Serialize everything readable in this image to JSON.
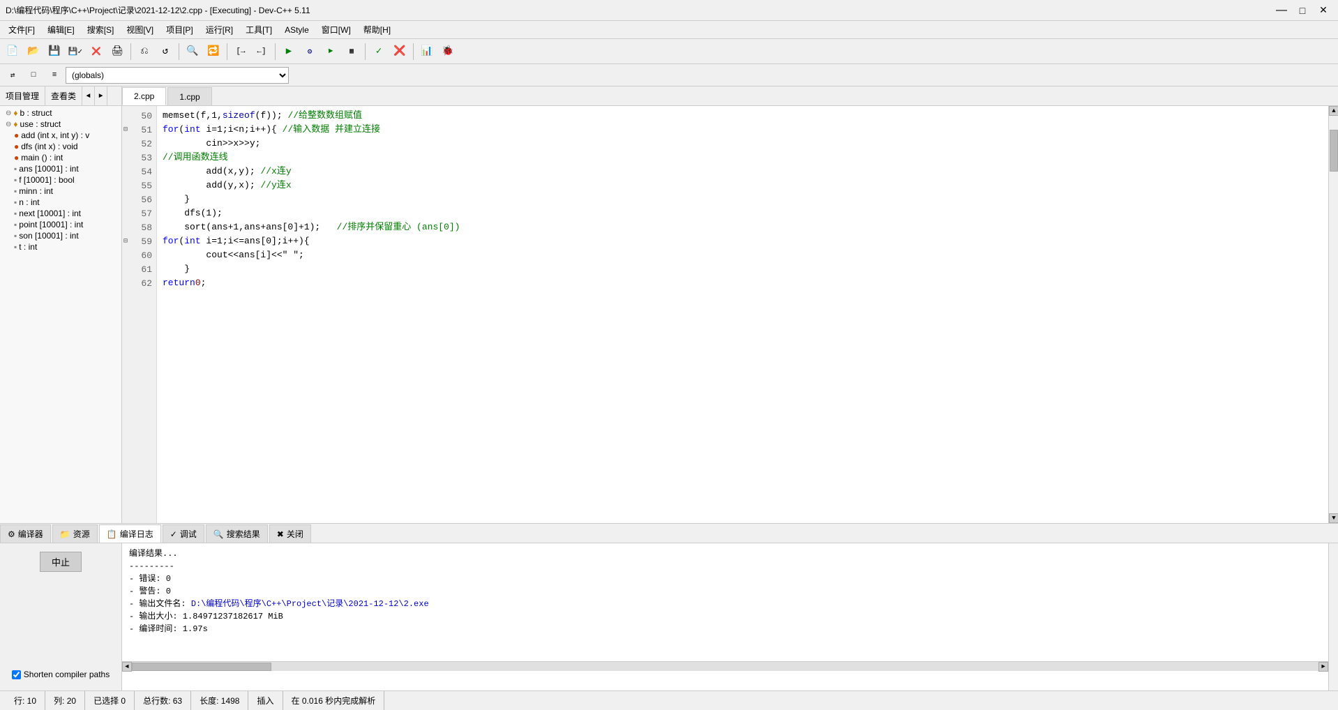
{
  "titlebar": {
    "title": "D:\\编程代码\\程序\\C++\\Project\\记录\\2021-12-12\\2.cpp - [Executing] - Dev-C++ 5.11",
    "minimize": "—",
    "maximize": "□",
    "close": "✕"
  },
  "menubar": {
    "items": [
      "文件[F]",
      "编辑[E]",
      "搜索[S]",
      "视图[V]",
      "项目[P]",
      "运行[R]",
      "工具[T]",
      "AStyle",
      "窗口[W]",
      "帮助[H]"
    ]
  },
  "toolbar2": {
    "globals_value": "(globals)"
  },
  "left_panel": {
    "tabs": [
      "项目管理",
      "查看类"
    ],
    "tree_items": [
      {
        "indent": 0,
        "expand": true,
        "icon": "struct",
        "label": "b : struct"
      },
      {
        "indent": 0,
        "expand": true,
        "icon": "struct",
        "label": "use : struct"
      },
      {
        "indent": 1,
        "icon": "func",
        "label": "add (int x, int y) : v"
      },
      {
        "indent": 1,
        "icon": "func",
        "label": "dfs (int x) : void"
      },
      {
        "indent": 1,
        "icon": "func",
        "label": "main () : int"
      },
      {
        "indent": 1,
        "icon": "var",
        "label": "ans [10001] : int"
      },
      {
        "indent": 1,
        "icon": "var",
        "label": "f [10001] : bool"
      },
      {
        "indent": 1,
        "icon": "var",
        "label": "minn : int"
      },
      {
        "indent": 1,
        "icon": "var",
        "label": "n : int"
      },
      {
        "indent": 1,
        "icon": "var",
        "label": "next [10001] : int"
      },
      {
        "indent": 1,
        "icon": "var",
        "label": "point [10001] : int"
      },
      {
        "indent": 1,
        "icon": "var",
        "label": "son [10001] : int"
      },
      {
        "indent": 1,
        "icon": "var",
        "label": "t : int"
      }
    ]
  },
  "editor": {
    "tabs": [
      "2.cpp",
      "1.cpp"
    ],
    "active_tab": "2.cpp",
    "lines": [
      {
        "num": 50,
        "code": "    memset(f,1,sizeof(f)); //给整数数组赋值"
      },
      {
        "num": 51,
        "code": "    for(int i=1;i<n;i++){ //输入数据 并建立连接",
        "marker": true
      },
      {
        "num": 52,
        "code": "        cin>>x>>y;"
      },
      {
        "num": 53,
        "code": "        //调用函数连线"
      },
      {
        "num": 54,
        "code": "        add(x,y); //x连y"
      },
      {
        "num": 55,
        "code": "        add(y,x); //y连x"
      },
      {
        "num": 56,
        "code": "    }"
      },
      {
        "num": 57,
        "code": "    dfs(1);"
      },
      {
        "num": 58,
        "code": "    sort(ans+1,ans+ans[0]+1);   //排序并保留重心 (ans[0])"
      },
      {
        "num": 59,
        "code": "    for(int i=1;i<=ans[0];i++){",
        "marker": true
      },
      {
        "num": 60,
        "code": "        cout<<ans[i]<<\" \";"
      },
      {
        "num": 61,
        "code": "    }"
      },
      {
        "num": 62,
        "code": "    return 0;"
      }
    ]
  },
  "bottom_panel": {
    "tabs": [
      {
        "label": "编译器",
        "icon": "compile-icon"
      },
      {
        "label": "资源",
        "icon": "resource-icon"
      },
      {
        "label": "编译日志",
        "icon": "log-icon"
      },
      {
        "label": "调试",
        "icon": "debug-icon"
      },
      {
        "label": "搜索结果",
        "icon": "search-result-icon"
      },
      {
        "label": "关闭",
        "icon": "close-icon"
      }
    ],
    "active_tab": "编译日志",
    "stop_button": "中止",
    "shorten_label": "Shorten compiler paths",
    "output_lines": [
      "编译结果...",
      "---------",
      "- 错误: 0",
      "- 警告: 0",
      "- 输出文件名: D:\\编程代码\\程序\\C++\\Project\\记录\\2021-12-12\\2.exe",
      "- 输出大小: 1.84971237182617 MiB",
      "- 编译时间: 1.97s"
    ]
  },
  "statusbar": {
    "row": "行: 10",
    "col": "列: 20",
    "selected": "已选择    0",
    "total_lines": "总行数: 63",
    "length": "长度: 1498",
    "insert": "插入",
    "parse_time": "在 0.016 秒内完成解析"
  }
}
